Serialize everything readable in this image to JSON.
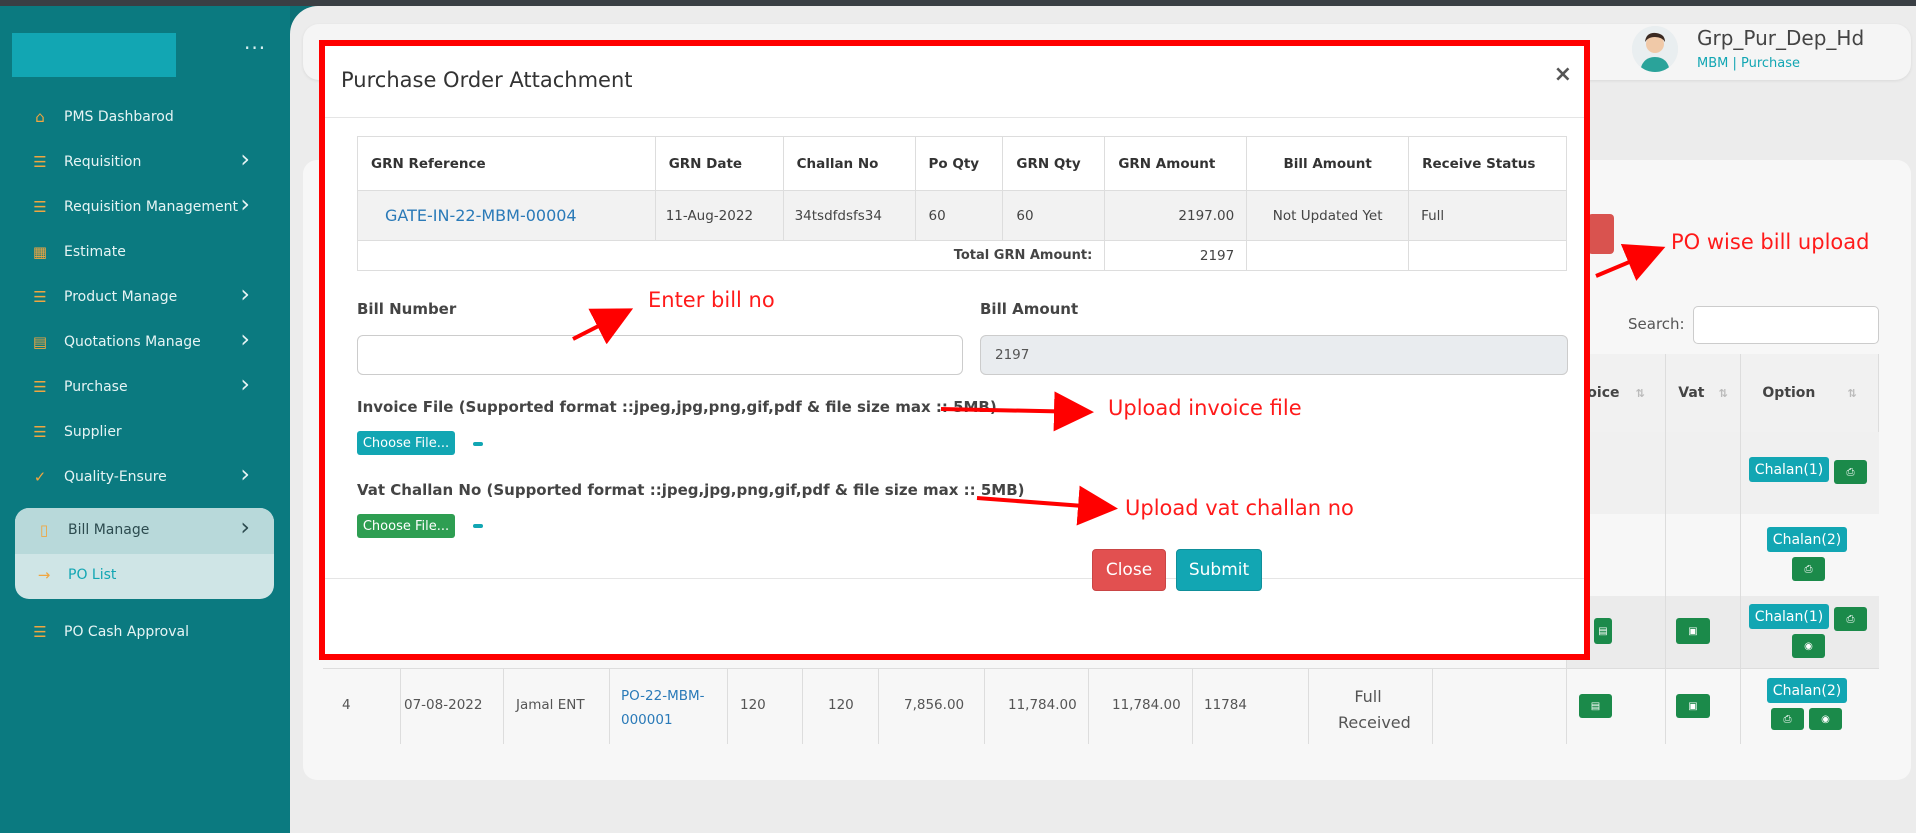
{
  "sidebar": {
    "items": [
      {
        "label": "PMS Dashbarod",
        "icon": "home-icon",
        "has_children": false
      },
      {
        "label": "Requisition",
        "icon": "list-icon",
        "has_children": true
      },
      {
        "label": "Requisition Management",
        "icon": "list-icon",
        "has_children": true
      },
      {
        "label": "Estimate",
        "icon": "building-icon",
        "has_children": false
      },
      {
        "label": "Product Manage",
        "icon": "list-icon",
        "has_children": true
      },
      {
        "label": "Quotations Manage",
        "icon": "document-icon",
        "has_children": true
      },
      {
        "label": "Purchase",
        "icon": "list-icon",
        "has_children": true
      },
      {
        "label": "Supplier",
        "icon": "list-icon",
        "has_children": false
      },
      {
        "label": "Quality-Ensure",
        "icon": "check-icon",
        "has_children": true
      },
      {
        "label": "Bill Manage",
        "icon": "file-icon",
        "has_children": true
      },
      {
        "label": "PO List",
        "icon": "arrow-right-icon",
        "has_children": false
      },
      {
        "label": "PO Cash Approval",
        "icon": "list-icon",
        "has_children": false
      }
    ]
  },
  "header": {
    "user_name": "Grp_Pur_Dep_Hd",
    "user_sub": "MBM  | Purchase"
  },
  "background": {
    "search_label": "Search:",
    "columns": [
      "oice",
      "Vat",
      "Option"
    ],
    "row4": {
      "index": "4",
      "date": "07-08-2022",
      "supplier": "Jamal ENT",
      "po": "PO-22-MBM-000001",
      "po_qty": "120",
      "grn_qty": "120",
      "amount1": "7,856.00",
      "amount2": "11,784.00",
      "amount3": "11,784.00",
      "amount4": "11784",
      "status": "Full Received"
    },
    "chalan_labels": [
      "Chalan(1)",
      "Chalan(2)",
      "Chalan(1)",
      "Chalan(2)"
    ]
  },
  "modal": {
    "title": "Purchase Order Attachment",
    "close_x": "×",
    "table": {
      "headers": [
        "GRN Reference",
        "GRN Date",
        "Challan No",
        "Po Qty",
        "GRN Qty",
        "GRN Amount",
        "Bill Amount",
        "Receive Status"
      ],
      "row": {
        "grn_reference": "GATE-IN-22-MBM-00004",
        "grn_date": "11-Aug-2022",
        "challan_no": "34tsdfdsfs34",
        "po_qty": "60",
        "grn_qty": "60",
        "grn_amount": "2197.00",
        "bill_amount": "Not Updated Yet",
        "receive_status": "Full"
      },
      "total_label": "Total GRN Amount:",
      "total_value": "2197"
    },
    "bill_number_label": "Bill Number",
    "bill_number_value": "",
    "bill_amount_label": "Bill Amount",
    "bill_amount_value": "2197",
    "invoice_label": "Invoice File (Supported format ::jpeg,jpg,png,gif,pdf & file size max :: 5MB)",
    "invoice_button": "Choose File...",
    "vat_label": "Vat Challan No (Supported format ::jpeg,jpg,png,gif,pdf & file size max :: 5MB)",
    "vat_button": "Choose File...",
    "close_button": "Close",
    "submit_button": "Submit"
  },
  "annotations": {
    "enter_bill": "Enter bill no",
    "upload_invoice": "Upload invoice file",
    "upload_vat": "Upload vat challan no",
    "po_wise": "PO wise bill upload"
  },
  "colors": {
    "sidebar": "#0b7a80",
    "accent": "#12a6b3",
    "danger": "#e25050",
    "success": "#1b8a4a",
    "highlight": "#ff0000"
  }
}
